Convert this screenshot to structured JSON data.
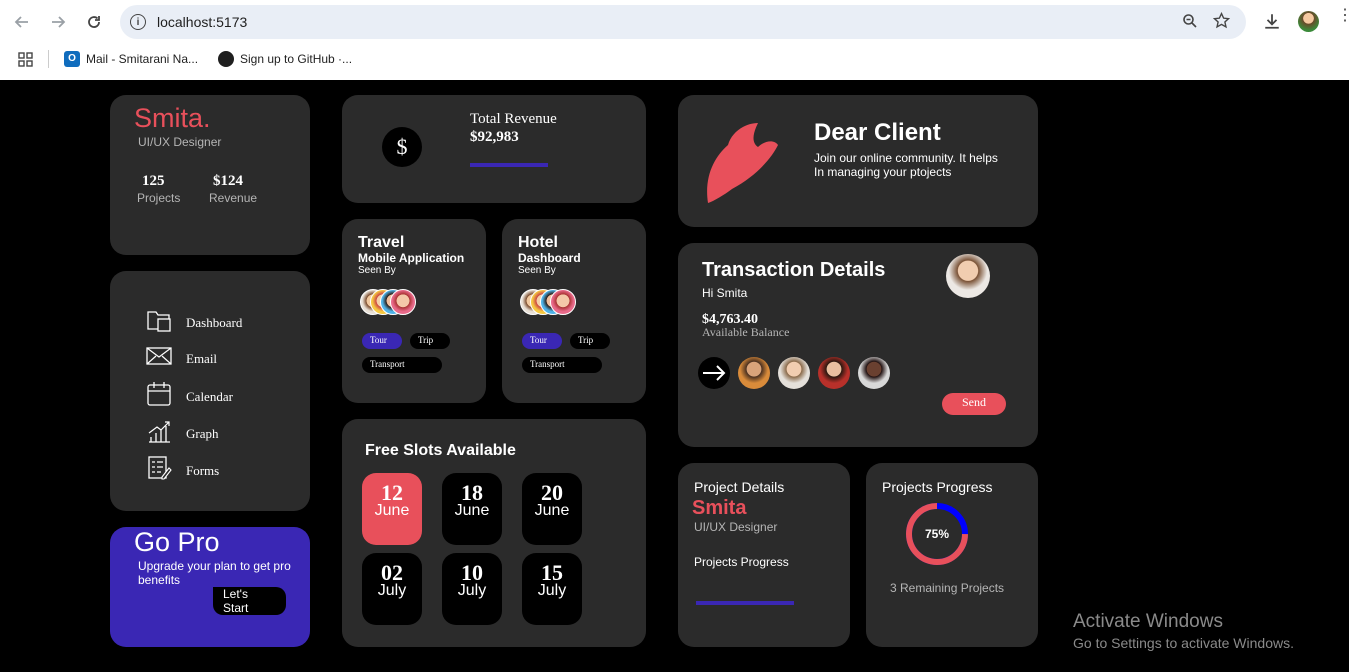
{
  "browser": {
    "url": "localhost:5173",
    "bookmarks": [
      "Mail - Smitarani Na...",
      "Sign up to GitHub ·..."
    ]
  },
  "profile": {
    "name": "Smita.",
    "role": "UI/UX Designer",
    "projects_value": "125",
    "projects_label": "Projects",
    "revenue_value": "$124",
    "revenue_label": "Revenue"
  },
  "menu": {
    "items": [
      {
        "label": "Dashboard",
        "icon": "folder-icon"
      },
      {
        "label": "Email",
        "icon": "mail-icon"
      },
      {
        "label": "Calendar",
        "icon": "calendar-icon"
      },
      {
        "label": "Graph",
        "icon": "graph-icon"
      },
      {
        "label": "Forms",
        "icon": "forms-icon"
      }
    ]
  },
  "gopro": {
    "title": "Go Pro",
    "text": "Upgrade your plan to get pro benefits",
    "button": "Let's Start"
  },
  "revenue": {
    "symbol": "$",
    "title": "Total Revenue",
    "value": "$92,983"
  },
  "travel": {
    "title": "Travel",
    "subtitle": "Mobile Application",
    "seen": "Seen By",
    "tags": [
      "Tour",
      "Trip",
      "Transport"
    ]
  },
  "hotel": {
    "title": "Hotel",
    "subtitle": "Dashboard",
    "seen": "Seen By",
    "tags": [
      "Tour",
      "Trip",
      "Transport"
    ]
  },
  "slots": {
    "title": "Free Slots Available",
    "items": [
      {
        "day": "12",
        "month": "June"
      },
      {
        "day": "18",
        "month": "June"
      },
      {
        "day": "20",
        "month": "June"
      },
      {
        "day": "02",
        "month": "July"
      },
      {
        "day": "10",
        "month": "July"
      },
      {
        "day": "15",
        "month": "July"
      }
    ]
  },
  "client": {
    "title": "Dear Client",
    "text": "Join our online community. It helps In managing your ptojects"
  },
  "transaction": {
    "title": "Transaction Details",
    "greeting": "Hi Smita",
    "amount": "$4,763.40",
    "balance_label": "Available Balance",
    "send": "Send"
  },
  "project": {
    "title": "Project Details",
    "name": "Smita",
    "role": "UI/UX Designer",
    "progress_label": "Projects Progress"
  },
  "progress": {
    "title": "Projects Progress",
    "percent_label": "75%",
    "percent": 0.75,
    "remaining": "3 Remaining Projects"
  },
  "watermark": {
    "title": "Activate Windows",
    "subtitle": "Go to Settings to activate Windows."
  },
  "colors": {
    "accent": "#e8505b",
    "purple": "#3a27b4",
    "card": "#2b2b2b"
  }
}
